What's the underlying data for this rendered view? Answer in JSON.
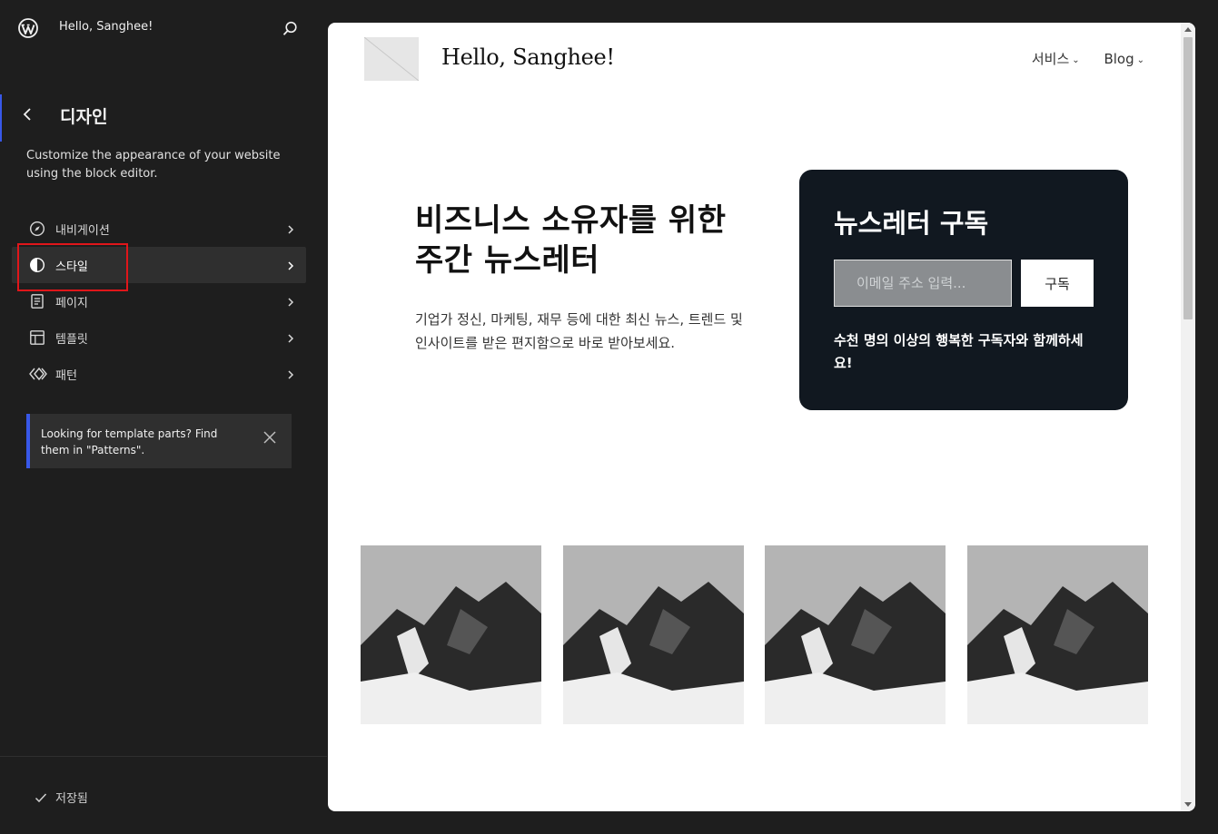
{
  "topbar": {
    "site_title": "Hello, Sanghee!",
    "logo_icon": "wordpress-logo-icon",
    "search_icon": "search-icon"
  },
  "panel": {
    "title": "디자인",
    "description": "Customize the appearance of your website using the block editor.",
    "back_icon": "chevron-left-icon"
  },
  "nav": {
    "items": [
      {
        "label": "내비게이션",
        "icon": "compass-icon",
        "active": false
      },
      {
        "label": "스타일",
        "icon": "half-circle-contrast-icon",
        "active": true
      },
      {
        "label": "페이지",
        "icon": "page-icon",
        "active": false
      },
      {
        "label": "템플릿",
        "icon": "layout-icon",
        "active": false
      },
      {
        "label": "패턴",
        "icon": "diamond-pattern-icon",
        "active": false
      }
    ]
  },
  "notice": {
    "text": "Looking for template parts? Find them in \"Patterns\".",
    "close_icon": "close-icon"
  },
  "footer": {
    "saved_label": "저장됨",
    "check_icon": "check-icon"
  },
  "preview": {
    "site_name": "Hello, Sanghee!",
    "nav_links": [
      "서비스",
      "Blog"
    ],
    "hero_title": "비즈니스 소유자를 위한 주간 뉴스레터",
    "hero_description": "기업가 정신, 마케팅, 재무 등에 대한 최신 뉴스, 트렌드 및 인사이트를 받은 편지함으로 바로 받아보세요.",
    "newsletter": {
      "title": "뉴스레터 구독",
      "email_placeholder": "이메일 주소 입력...",
      "button_label": "구독",
      "subtext": "수천 명의 이상의 행복한 구독자와 함께하세요!"
    },
    "gallery_count": 4
  },
  "colors": {
    "sidebar_bg": "#1e1e1e",
    "active_item_bg": "#2f2f2f",
    "accent_blue": "#3858e9",
    "highlight_red": "#e0161a",
    "card_dark": "#111820"
  }
}
